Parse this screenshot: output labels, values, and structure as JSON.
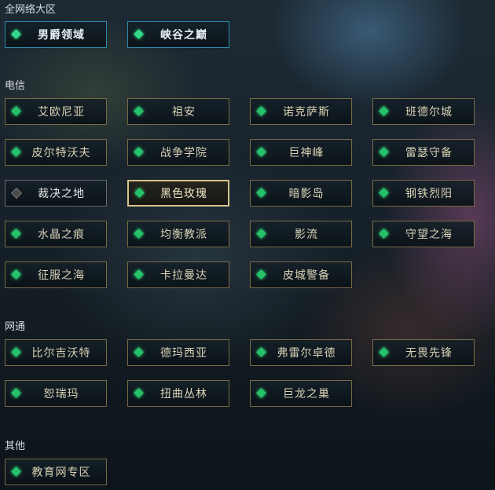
{
  "sections": {
    "all_network": "全网络大区",
    "telecom": "电信",
    "netcom": "网通",
    "other": "其他"
  },
  "top_servers": [
    "男爵领域",
    "峡谷之巅"
  ],
  "telecom_servers": [
    "艾欧尼亚",
    "祖安",
    "诺克萨斯",
    "班德尔城",
    "皮尔特沃夫",
    "战争学院",
    "巨神峰",
    "雷瑟守备",
    "裁决之地",
    "黑色玫瑰",
    "暗影岛",
    "钢铁烈阳",
    "水晶之痕",
    "均衡教派",
    "影流",
    "守望之海",
    "征服之海",
    "卡拉曼达",
    "皮城警备"
  ],
  "netcom_servers": [
    "比尔吉沃特",
    "德玛西亚",
    "弗雷尔卓德",
    "无畏先锋",
    "恕瑞玛",
    "扭曲丛林",
    "巨龙之巢"
  ],
  "other_servers": [
    "教育网专区"
  ],
  "colors": {
    "accent_green": "#26c26a",
    "border_gold": "#7a6a45",
    "border_blue": "#2f8aa8",
    "highlight": "#d8c48c"
  },
  "icons": {
    "status": "diamond-status-icon"
  }
}
